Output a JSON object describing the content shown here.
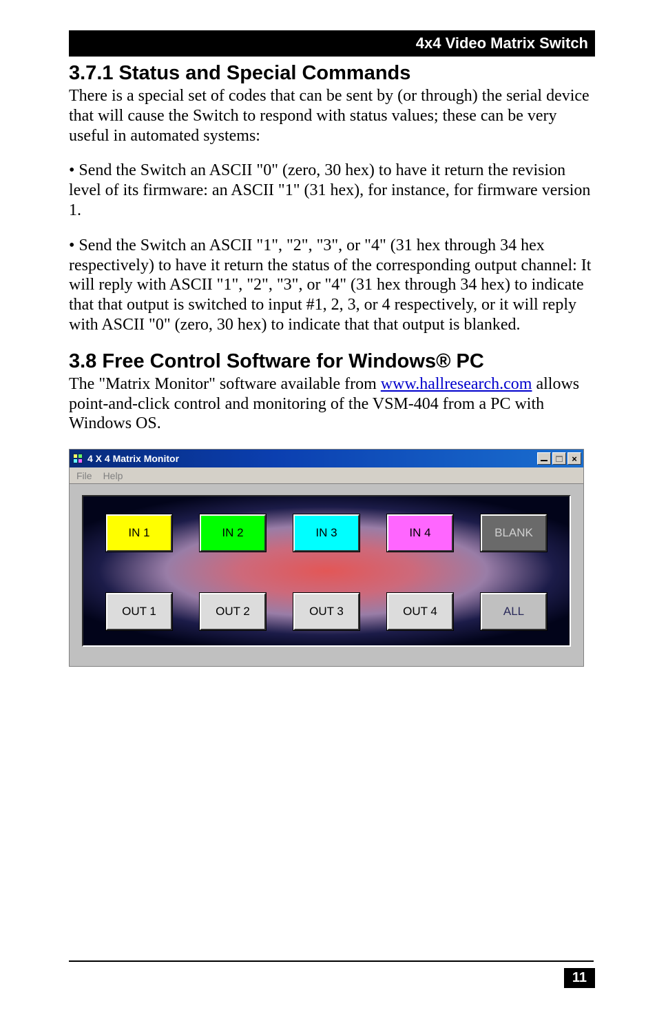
{
  "header": {
    "title": "4x4 Video Matrix Switch"
  },
  "sections": {
    "status_cmds": {
      "heading": "3.7.1 Status and Special Commands",
      "p1": "There is a special set of codes that can be sent by (or through) the serial device that will cause the Switch to respond with status values; these can be very useful in automated systems:",
      "p2": "• Send the Switch an ASCII \"0\" (zero, 30 hex) to have it return the revision level of its firmware: an ASCII \"1\" (31 hex), for instance, for firmware version 1.",
      "p3": "• Send the Switch an ASCII \"1\", \"2\", \"3\", or \"4\" (31 hex through 34 hex respectively) to have it return the status of the corresponding output channel: It will reply with ASCII \"1\", \"2\", \"3\", or \"4\" (31 hex through 34 hex) to indicate that that output is switched to input #1, 2, 3, or 4 respectively, or it will reply with ASCII \"0\" (zero, 30 hex) to indicate that that output is blanked."
    },
    "software": {
      "heading": "3.8 Free Control Software for Windows® PC",
      "p1a": "The \"Matrix Monitor\" software available from ",
      "link_text": "www.hallresearch.com",
      "p1b": " allows point-and-click control and monitoring of the VSM-404 from a PC with Windows OS."
    }
  },
  "mm": {
    "title": "4 X 4 Matrix Monitor",
    "menu": {
      "file": "File",
      "help": "Help"
    },
    "title_buttons": {
      "min": "minimize",
      "max": "restore",
      "close": "×"
    },
    "inputs": {
      "in1": "IN 1",
      "in2": "IN 2",
      "in3": "IN 3",
      "in4": "IN 4",
      "blank": "BLANK"
    },
    "outputs": {
      "out1": "OUT 1",
      "out2": "OUT 2",
      "out3": "OUT 3",
      "out4": "OUT 4",
      "all": "ALL"
    }
  },
  "footer": {
    "page": "11"
  }
}
